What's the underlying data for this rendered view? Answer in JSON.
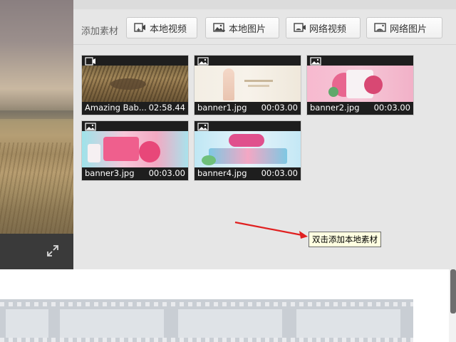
{
  "toolbar": {
    "label": "添加素材",
    "buttons": [
      {
        "label": "本地视频",
        "icon": "video-add-icon"
      },
      {
        "label": "本地图片",
        "icon": "image-add-icon"
      },
      {
        "label": "网络视频",
        "icon": "network-video-icon"
      },
      {
        "label": "网络图片",
        "icon": "network-image-icon"
      }
    ]
  },
  "materials": [
    {
      "name": "Amazing Bab...",
      "duration": "02:58.44",
      "type": "video"
    },
    {
      "name": "banner1.jpg",
      "duration": "00:03.00",
      "type": "image"
    },
    {
      "name": "banner2.jpg",
      "duration": "00:03.00",
      "type": "image"
    },
    {
      "name": "banner3.jpg",
      "duration": "00:03.00",
      "type": "image"
    },
    {
      "name": "banner4.jpg",
      "duration": "00:03.00",
      "type": "image"
    }
  ],
  "tooltip": {
    "text": "双击添加本地素材"
  },
  "colors": {
    "arrow": "#e02020",
    "panel_bg": "#e6e6e6",
    "tooltip_bg": "#ffffe1"
  }
}
